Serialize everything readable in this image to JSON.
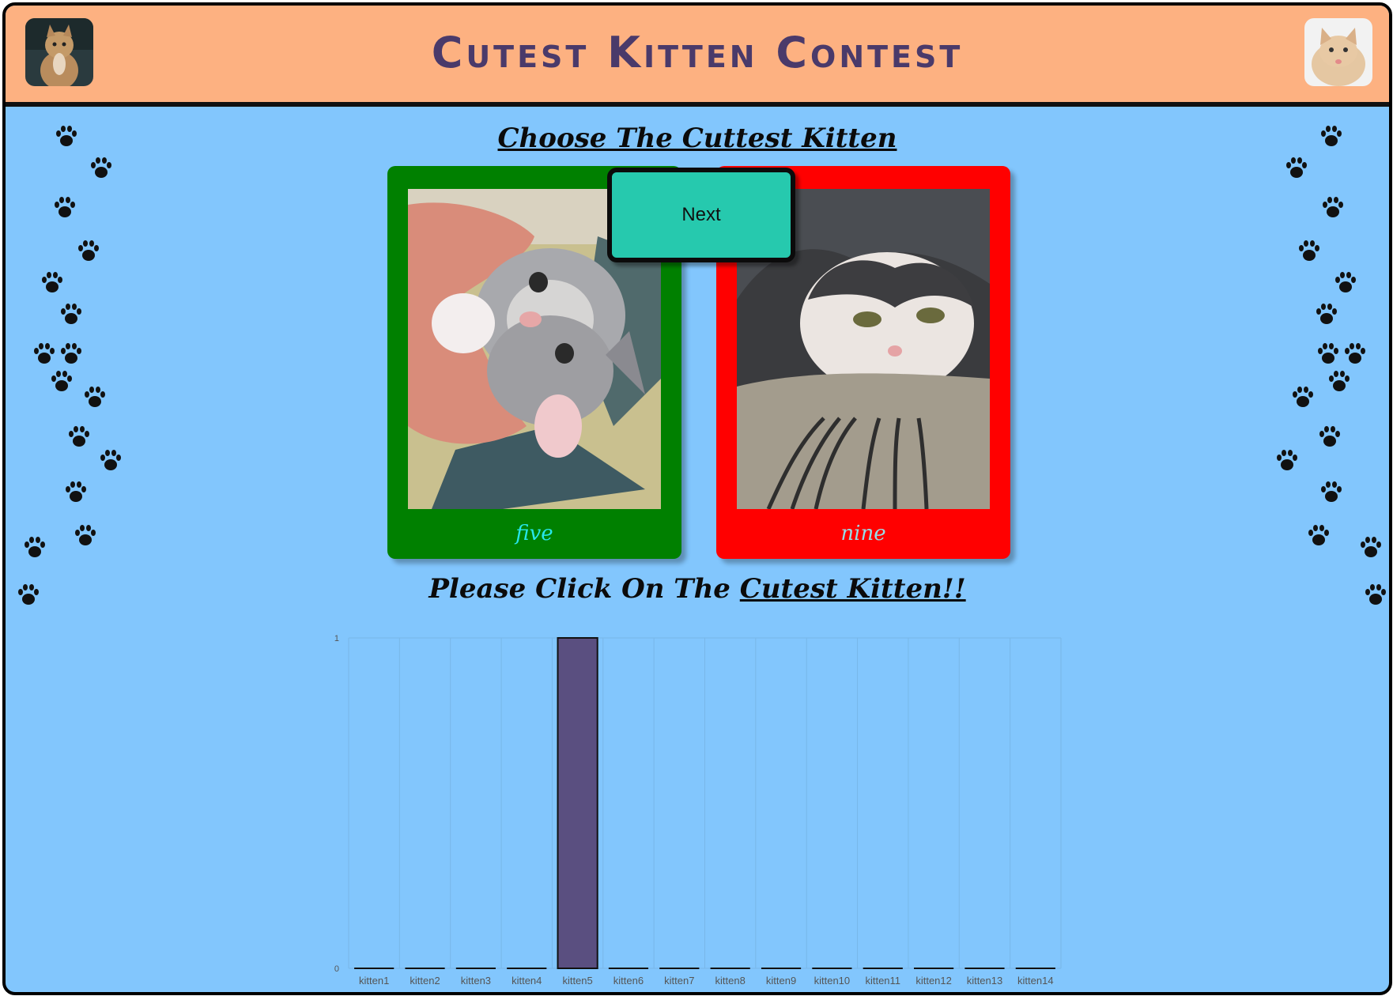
{
  "header": {
    "title": "Cutest Kitten Contest",
    "left_thumb_icon": "kitten-photo",
    "right_thumb_icon": "kitten-photo",
    "bg_color": "#fdb181",
    "title_color": "#4a3a6a"
  },
  "prompt_heading": "Choose The Cuttest Kitten",
  "next_button_label": "Next",
  "cards": [
    {
      "caption": "five",
      "border_color": "#008000"
    },
    {
      "caption": "nine",
      "border_color": "#ff0000"
    }
  ],
  "instruction": {
    "prefix": "Please Click On The",
    "emphasis": "Cutest Kitten!!"
  },
  "decor": {
    "paw_icon": "paw-print-icon"
  },
  "chart_data": {
    "type": "bar",
    "categories": [
      "kitten1",
      "kitten2",
      "kitten3",
      "kitten4",
      "kitten5",
      "kitten6",
      "kitten7",
      "kitten8",
      "kitten9",
      "kitten10",
      "kitten11",
      "kitten12",
      "kitten13",
      "kitten14"
    ],
    "values": [
      0,
      0,
      0,
      0,
      1,
      0,
      0,
      0,
      0,
      0,
      0,
      0,
      0,
      0
    ],
    "ylim": [
      0,
      1
    ],
    "yticks": [
      "0",
      "1"
    ],
    "grid": true,
    "bar_color": "#5a4f80",
    "bar_border_color": "#111111"
  }
}
